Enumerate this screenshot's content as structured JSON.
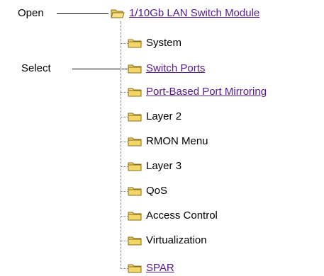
{
  "callouts": {
    "open": "Open",
    "select": "Select"
  },
  "tree": {
    "root": {
      "label": "1/10Gb LAN Switch Module",
      "icon": "open-folder-icon",
      "link": true
    },
    "items": [
      {
        "label": "System",
        "icon": "folder-icon",
        "link": false
      },
      {
        "label": "Switch Ports",
        "icon": "folder-icon",
        "link": true
      },
      {
        "label": "Port-Based Port Mirroring",
        "icon": "folder-icon",
        "link": true
      },
      {
        "label": "Layer 2",
        "icon": "folder-icon",
        "link": false
      },
      {
        "label": "RMON Menu",
        "icon": "folder-icon",
        "link": false
      },
      {
        "label": "Layer 3",
        "icon": "folder-icon",
        "link": false
      },
      {
        "label": "QoS",
        "icon": "folder-icon",
        "link": false
      },
      {
        "label": "Access Control",
        "icon": "folder-icon",
        "link": false
      },
      {
        "label": "Virtualization",
        "icon": "folder-icon",
        "link": false
      },
      {
        "label": "SPAR",
        "icon": "folder-icon",
        "link": true
      }
    ]
  },
  "colors": {
    "link": "#551a8b",
    "folder_fill": "#f2d768",
    "folder_stroke": "#8a6d1a",
    "tree_line": "#7a7a7a"
  }
}
